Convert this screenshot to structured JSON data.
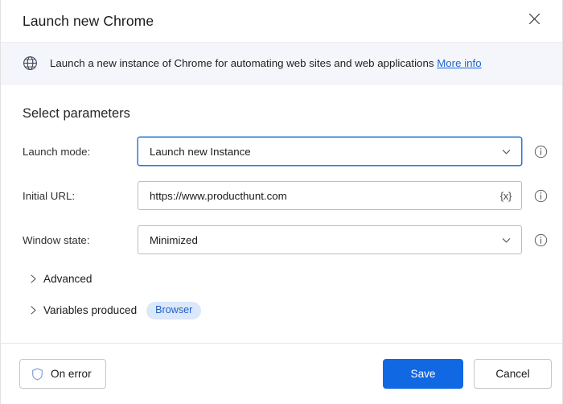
{
  "dialog": {
    "title": "Launch new Chrome",
    "close_icon": "close-icon"
  },
  "infobar": {
    "icon": "globe-icon",
    "text": "Launch a new instance of Chrome for automating web sites and web applications",
    "link_label": "More info"
  },
  "main": {
    "section_title": "Select parameters",
    "fields": [
      {
        "label": "Launch mode:",
        "value": "Launch new Instance",
        "type": "select",
        "trailing_icon": "chevron-down-icon",
        "focused": true,
        "info_icon": "info-icon"
      },
      {
        "label": "Initial URL:",
        "value": "https://www.producthunt.com",
        "type": "text",
        "trailing_icon": "{x}",
        "focused": false,
        "info_icon": "info-icon"
      },
      {
        "label": "Window state:",
        "value": "Minimized",
        "type": "select",
        "trailing_icon": "chevron-down-icon",
        "focused": false,
        "info_icon": "info-icon"
      }
    ],
    "collapsibles": [
      {
        "label": "Advanced",
        "icon": "chevron-right-icon",
        "expanded": false
      },
      {
        "label": "Variables produced",
        "icon": "chevron-right-icon",
        "expanded": false,
        "badge": "Browser"
      }
    ]
  },
  "footer": {
    "on_error_label": "On error",
    "on_error_icon": "shield-icon",
    "save_label": "Save",
    "cancel_label": "Cancel"
  },
  "colors": {
    "accent_blue": "#1168e3",
    "link_blue": "#1f66d0",
    "banner_bg": "#f4f6fb",
    "pill_bg": "#dbe8fb",
    "pill_text": "#1f5fc4",
    "focus_border": "#2a7ad4",
    "shield_blue": "#7b9fe0"
  }
}
